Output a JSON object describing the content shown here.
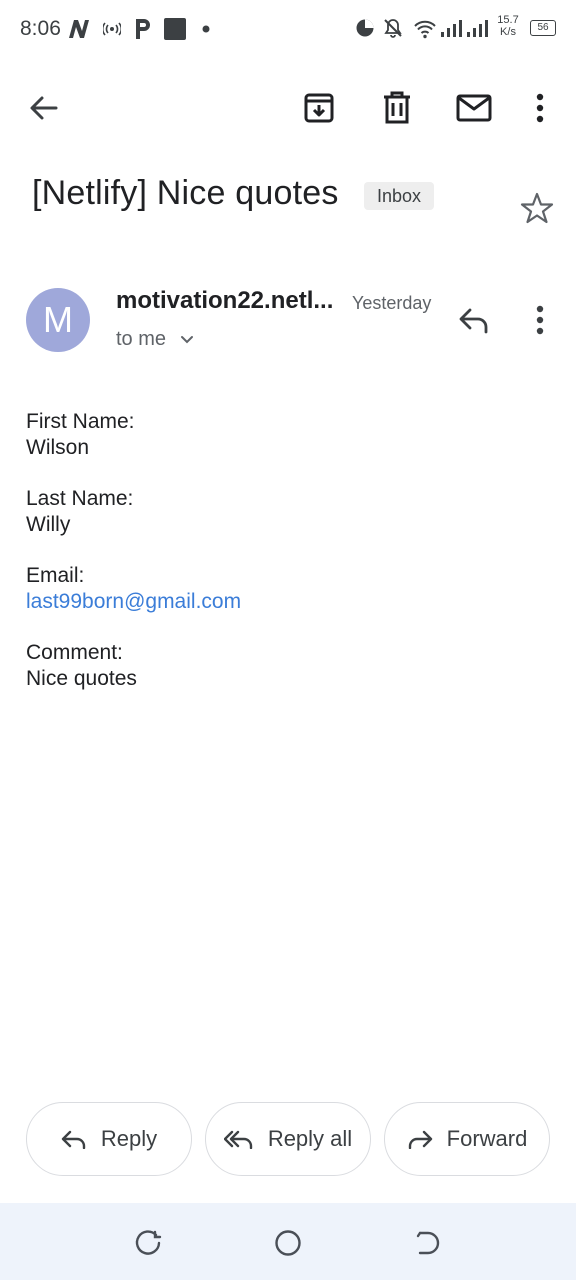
{
  "status_bar": {
    "time": "8:06",
    "speed_value": "15.7",
    "speed_unit": "K/s",
    "battery": "56"
  },
  "email": {
    "subject": "[Netlify] Nice quotes",
    "label": "Inbox",
    "avatar_letter": "M",
    "sender": "motivation22.netl...",
    "time": "Yesterday",
    "recipient": "to me",
    "fields": [
      {
        "label": "First Name:",
        "value": "Wilson"
      },
      {
        "label": "Last Name:",
        "value": "Willy"
      },
      {
        "label": "Email:",
        "value": "last99born@gmail.com"
      },
      {
        "label": "Comment:",
        "value": "Nice quotes"
      }
    ]
  },
  "actions": {
    "reply": "Reply",
    "reply_all": "Reply all",
    "forward": "Forward"
  },
  "icons": {
    "toolbar": [
      "back-arrow-icon",
      "archive-icon",
      "delete-icon",
      "mark-unread-icon",
      "more-vert-icon"
    ],
    "header": [
      "star-icon",
      "reply-icon",
      "more-vert-icon",
      "chevron-down-icon"
    ],
    "nav": [
      "recents-icon",
      "home-icon",
      "back-icon"
    ]
  },
  "colors": {
    "avatar": "#9fa8da",
    "link": "#3b7dd8",
    "nav_bar": "#eef3fb",
    "label_chip": "#eeeeee"
  }
}
